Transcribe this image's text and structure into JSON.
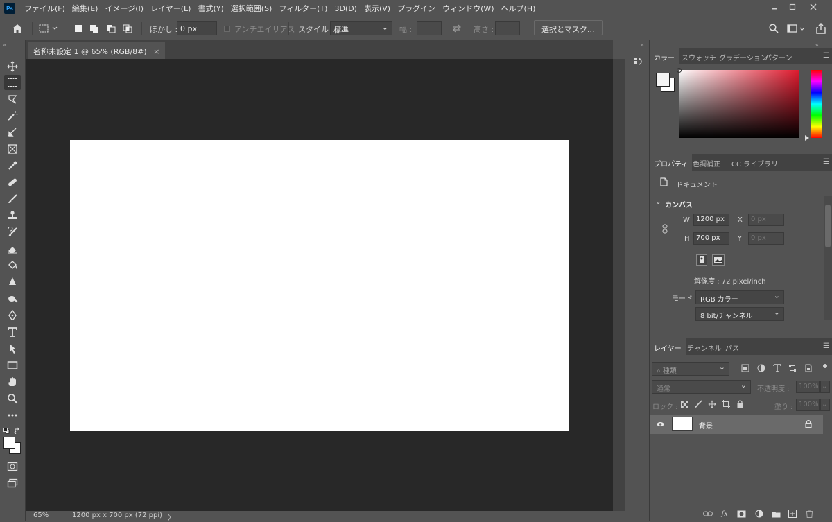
{
  "menubar": {
    "app_logo": "Ps",
    "items": [
      "ファイル(F)",
      "編集(E)",
      "イメージ(I)",
      "レイヤー(L)",
      "書式(Y)",
      "選択範囲(S)",
      "フィルター(T)",
      "3D(D)",
      "表示(V)",
      "プラグイン",
      "ウィンドウ(W)",
      "ヘルプ(H)"
    ]
  },
  "options": {
    "feather_label": "ぼかし :",
    "feather_value": "0 px",
    "antialias_label": "アンチエイリアス",
    "style_label": "スタイル :",
    "style_value": "標準",
    "width_label": "幅 :",
    "height_label": "高さ :",
    "select_mask_button": "選択とマスク..."
  },
  "document": {
    "tab_title": "名称未設定 1 @ 65% (RGB/8#)",
    "close_glyph": "×"
  },
  "status": {
    "zoom": "65%",
    "doc_info": "1200 px x 700 px (72 ppi)",
    "arrow": "〉"
  },
  "color_panel": {
    "tabs": [
      "カラー",
      "スウォッチ",
      "グラデーション",
      "パターン"
    ],
    "hue_color": "#e0192d"
  },
  "properties_panel": {
    "tabs": [
      "プロパティ",
      "色調補正",
      "CC ライブラリ"
    ],
    "doc_label": "ドキュメント",
    "canvas_header": "カンバス",
    "w_label": "W",
    "w_value": "1200 px",
    "h_label": "H",
    "h_value": "700 px",
    "x_label": "X",
    "x_value": "0 px",
    "y_label": "Y",
    "y_value": "0 px",
    "resolution": "解像度 : 72 pixel/inch",
    "mode_label": "モード",
    "mode_value": "RGB カラー",
    "depth_value": "8 bit/チャンネル"
  },
  "layers_panel": {
    "tabs": [
      "レイヤー",
      "チャンネル",
      "パス"
    ],
    "filter_placeholder": "種類",
    "blend_mode": "通常",
    "opacity_label": "不透明度 :",
    "opacity_value": "100%",
    "lock_label": "ロック :",
    "fill_label": "塗り :",
    "fill_value": "100%",
    "layer_name": "背景"
  }
}
